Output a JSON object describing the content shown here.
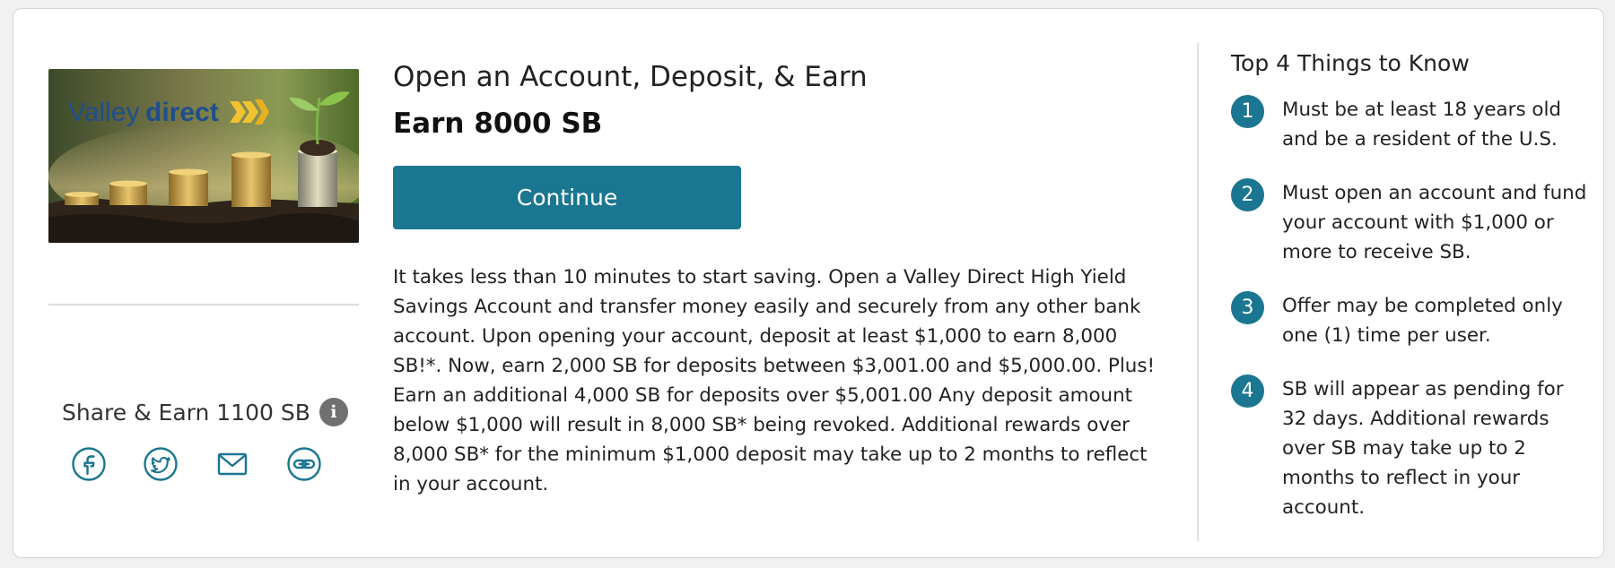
{
  "colors": {
    "accent": "#1a7691",
    "info_badge": "#707070",
    "background": "#f1f1f1",
    "card": "#ffffff"
  },
  "promo_image": {
    "brand_left": "Valley",
    "brand_right": "direct"
  },
  "offer": {
    "title": "Open an Account, Deposit, & Earn",
    "amount": "Earn 8000 SB",
    "continue_label": "Continue",
    "description": "It takes less than 10 minutes to start saving. Open a Valley Direct High Yield Savings Account and transfer money easily and securely from any other bank account. Upon opening your account, deposit at least $1,000 to earn 8,000 SB!*. Now, earn 2,000 SB for deposits between $3,001.00 and $5,000.00. Plus! Earn an additional 4,000 SB for deposits over $5,001.00 Any deposit amount below $1,000 will result in 8,000 SB* being revoked. Additional rewards over 8,000 SB* for the minimum $1,000 deposit may take up to 2 months to reflect in your account."
  },
  "share": {
    "label": "Share & Earn 1100 SB",
    "info_icon": "i",
    "icons": [
      "facebook-icon",
      "twitter-icon",
      "email-icon",
      "link-icon"
    ]
  },
  "things_to_know": {
    "title": "Top 4 Things to Know",
    "items": [
      {
        "number": "1",
        "text": "Must be at least 18 years old and be a resident of the U.S."
      },
      {
        "number": "2",
        "text": "Must open an account and fund your account with $1,000 or more to receive SB."
      },
      {
        "number": "3",
        "text": "Offer may be completed only one (1) time per user."
      },
      {
        "number": "4",
        "text": "SB will appear as pending for 32 days. Additional rewards over SB may take up to 2 months to reflect in your account."
      }
    ]
  }
}
